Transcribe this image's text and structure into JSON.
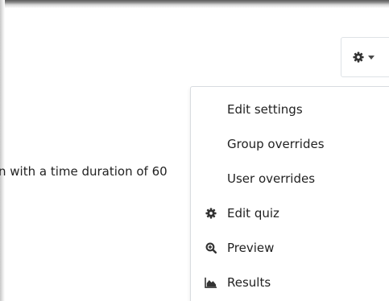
{
  "intro_text": "n with a time duration of 60",
  "actions_menu": {
    "toggle_icon": "gear-icon",
    "items": [
      {
        "label": "Edit settings",
        "icon": ""
      },
      {
        "label": "Group overrides",
        "icon": ""
      },
      {
        "label": "User overrides",
        "icon": ""
      },
      {
        "label": "Edit quiz",
        "icon": "gear-icon"
      },
      {
        "label": "Preview",
        "icon": "magnifier-icon"
      },
      {
        "label": "Results",
        "icon": "area-chart-icon"
      }
    ]
  },
  "colors": {
    "text": "#222222",
    "border": "#d8dce0",
    "icon": "#333333"
  }
}
